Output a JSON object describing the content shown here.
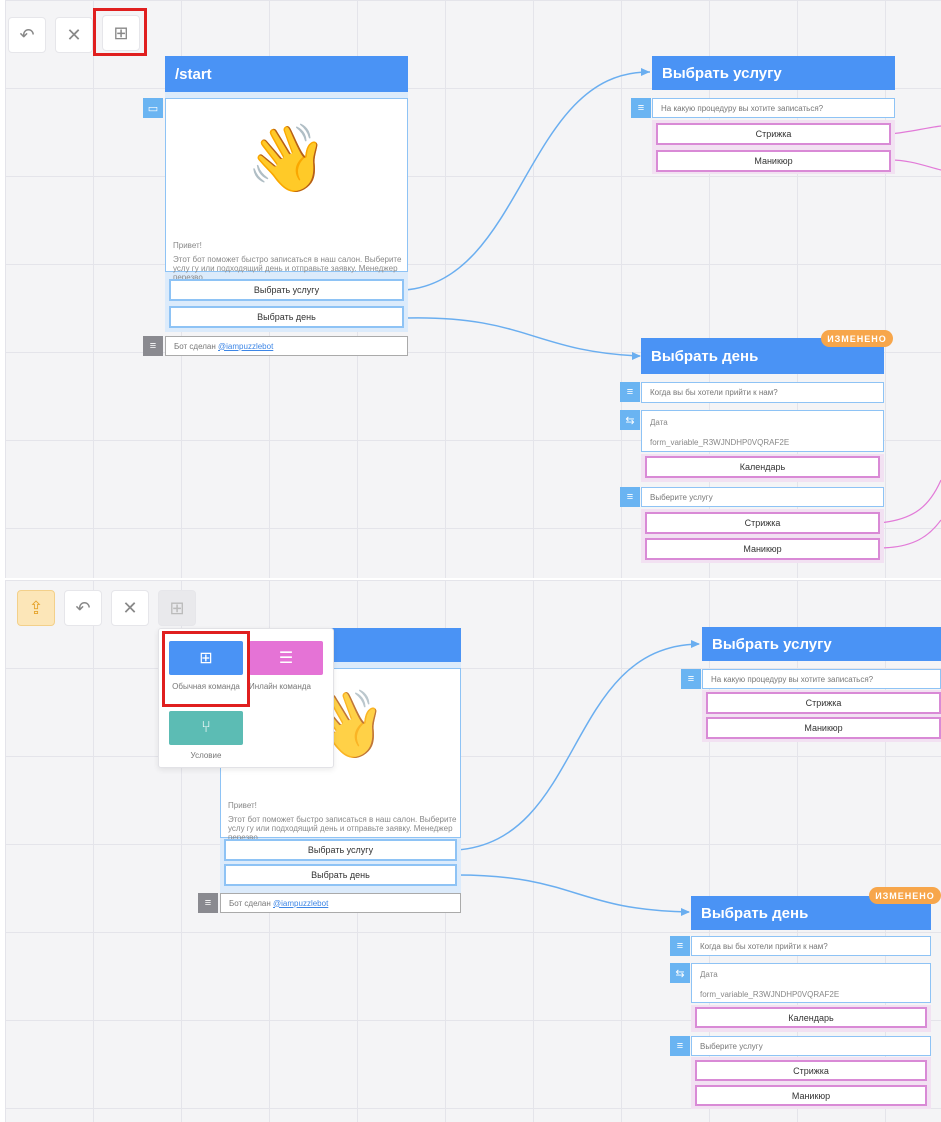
{
  "toolbar": {
    "undo_icon": "undo-icon",
    "close_icon": "close-icon",
    "add_icon": "add-block-icon",
    "upload_icon": "upload-icon",
    "undo_glyph": "↶",
    "close_glyph": "✕",
    "add_glyph": "⊞",
    "upload_glyph": "⇪"
  },
  "start_node": {
    "title": "/start",
    "image_icon": "image-icon",
    "image_emoji": "👋",
    "greeting_title": "Привет!",
    "greeting_body": "Этот бот поможет быстро записаться в наш салон. Выберите услу гу или подходящий день и отправьте заявку. Менеджер перезво...",
    "buttons": [
      "Выбрать услугу",
      "Выбрать день"
    ],
    "footer_prefix": "Бот сделан ",
    "footer_link": "@iampuzzlebot"
  },
  "service_node": {
    "title": "Выбрать услугу",
    "question": "На какую процедуру вы хотите записаться?",
    "buttons": [
      "Стрижка",
      "Маникюр"
    ]
  },
  "day_node": {
    "title": "Выбрать день",
    "badge": "ИЗМЕНЕНО",
    "question": "Когда вы бы хотели прийти к нам?",
    "input_label": "Дата",
    "input_variable": "form_variable_R3WJNDHP0VQRAF2E",
    "calendar_button": "Календарь",
    "service_question": "Выберите услугу",
    "buttons": [
      "Стрижка",
      "Маникюр"
    ]
  },
  "add_menu": {
    "items": [
      {
        "label": "Обычная команда",
        "icon": "grid-icon",
        "color": "#4a93f5",
        "glyph": "⊞"
      },
      {
        "label": "Инлайн команда",
        "icon": "inline-command-icon",
        "color": "#e573d6",
        "glyph": "☰"
      },
      {
        "label": "Условие",
        "icon": "branch-icon",
        "color": "#5cbcb4",
        "glyph": "⑂"
      }
    ]
  },
  "colors": {
    "header_blue": "#4a93f5",
    "badge_orange": "#f7a64b",
    "highlight_red": "#e01f1f",
    "pink_border": "#d98ad6"
  }
}
